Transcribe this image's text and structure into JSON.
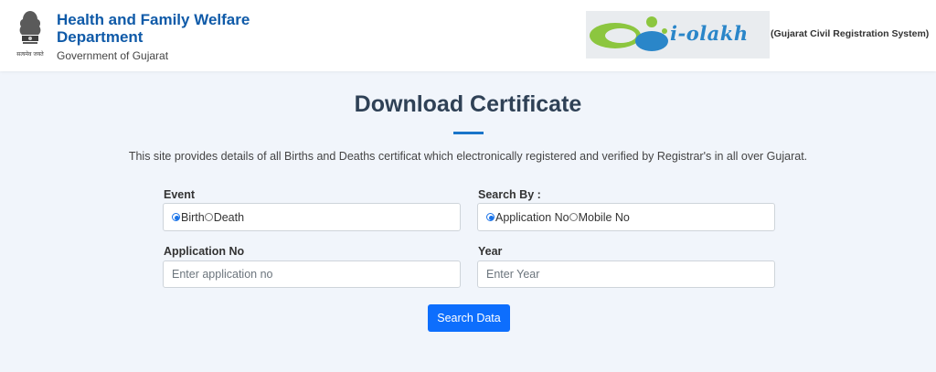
{
  "header": {
    "dept_line1": "Health and Family Welfare",
    "dept_line2": "Department",
    "government": "Government of Gujarat",
    "emblem_caption": "सत्यमेव जयते",
    "logo_text": "i-olakh",
    "system_name": "(Gujarat Civil Registration System)",
    "colors": {
      "brand_blue": "#0f5aa8",
      "accent_blue": "#1a75c9"
    }
  },
  "main": {
    "title": "Download Certificate",
    "info": "This site provides details of all Births and Deaths certificat which electronically registered and verified by Registrar's in all over Gujarat."
  },
  "form": {
    "event": {
      "label": "Event",
      "options": [
        {
          "label": "Birth",
          "selected": true
        },
        {
          "label": "Death",
          "selected": false
        }
      ]
    },
    "search_by": {
      "label": "Search By :",
      "options": [
        {
          "label": "Application No",
          "selected": true
        },
        {
          "label": "Mobile No",
          "selected": false
        }
      ]
    },
    "application_no": {
      "label": "Application No",
      "value": "",
      "placeholder": "Enter application no"
    },
    "year": {
      "label": "Year",
      "value": "",
      "placeholder": "Enter Year"
    },
    "submit_label": "Search Data",
    "colors": {
      "button": "#0d6efd"
    }
  }
}
